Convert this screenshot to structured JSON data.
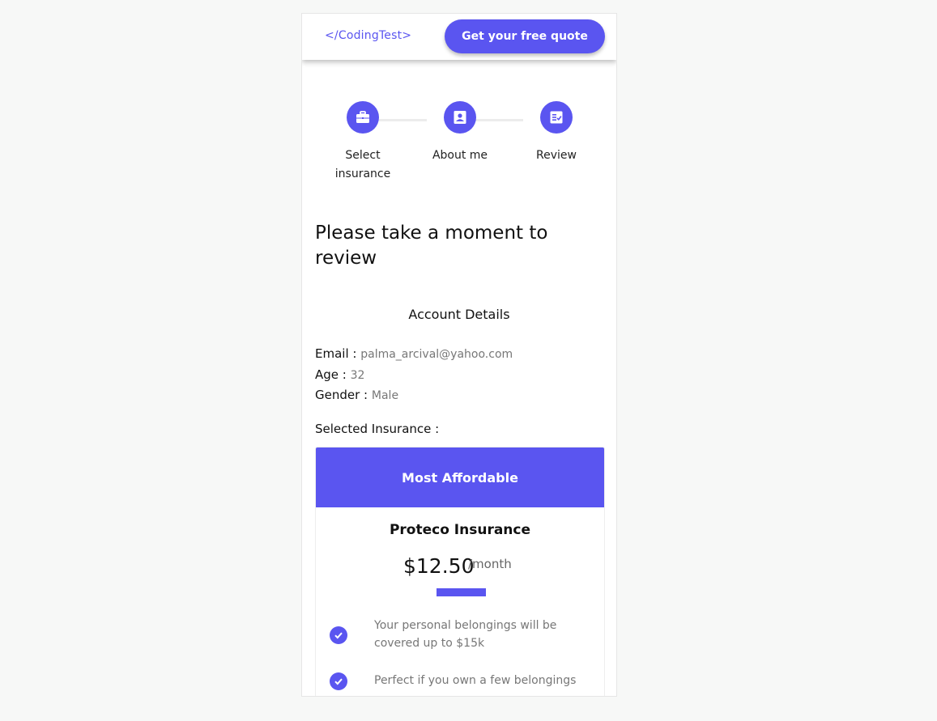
{
  "header": {
    "brand": "</CodingTest>",
    "cta_label": "Get your free quote"
  },
  "steps": [
    {
      "label": "Select insurance",
      "icon": "briefcase-icon"
    },
    {
      "label": "About me",
      "icon": "contact-icon"
    },
    {
      "label": "Review",
      "icon": "review-checklist-icon"
    }
  ],
  "page": {
    "title": "Please take a moment to review",
    "section_title": "Account Details"
  },
  "details": {
    "email_label": "Email :",
    "email_value": "palma_arcival@yahoo.com",
    "age_label": "Age :",
    "age_value": "32",
    "gender_label": "Gender :",
    "gender_value": "Male"
  },
  "selected": {
    "label": "Selected Insurance :",
    "badge": "Most Affordable",
    "provider": "Proteco Insurance",
    "price": "$12.50",
    "period": "/month",
    "features": [
      "Your personal belongings will be covered up to $15k",
      "Perfect if you own a few belongings"
    ]
  },
  "colors": {
    "accent": "#5a55f0",
    "background": "#f7f8f7"
  }
}
